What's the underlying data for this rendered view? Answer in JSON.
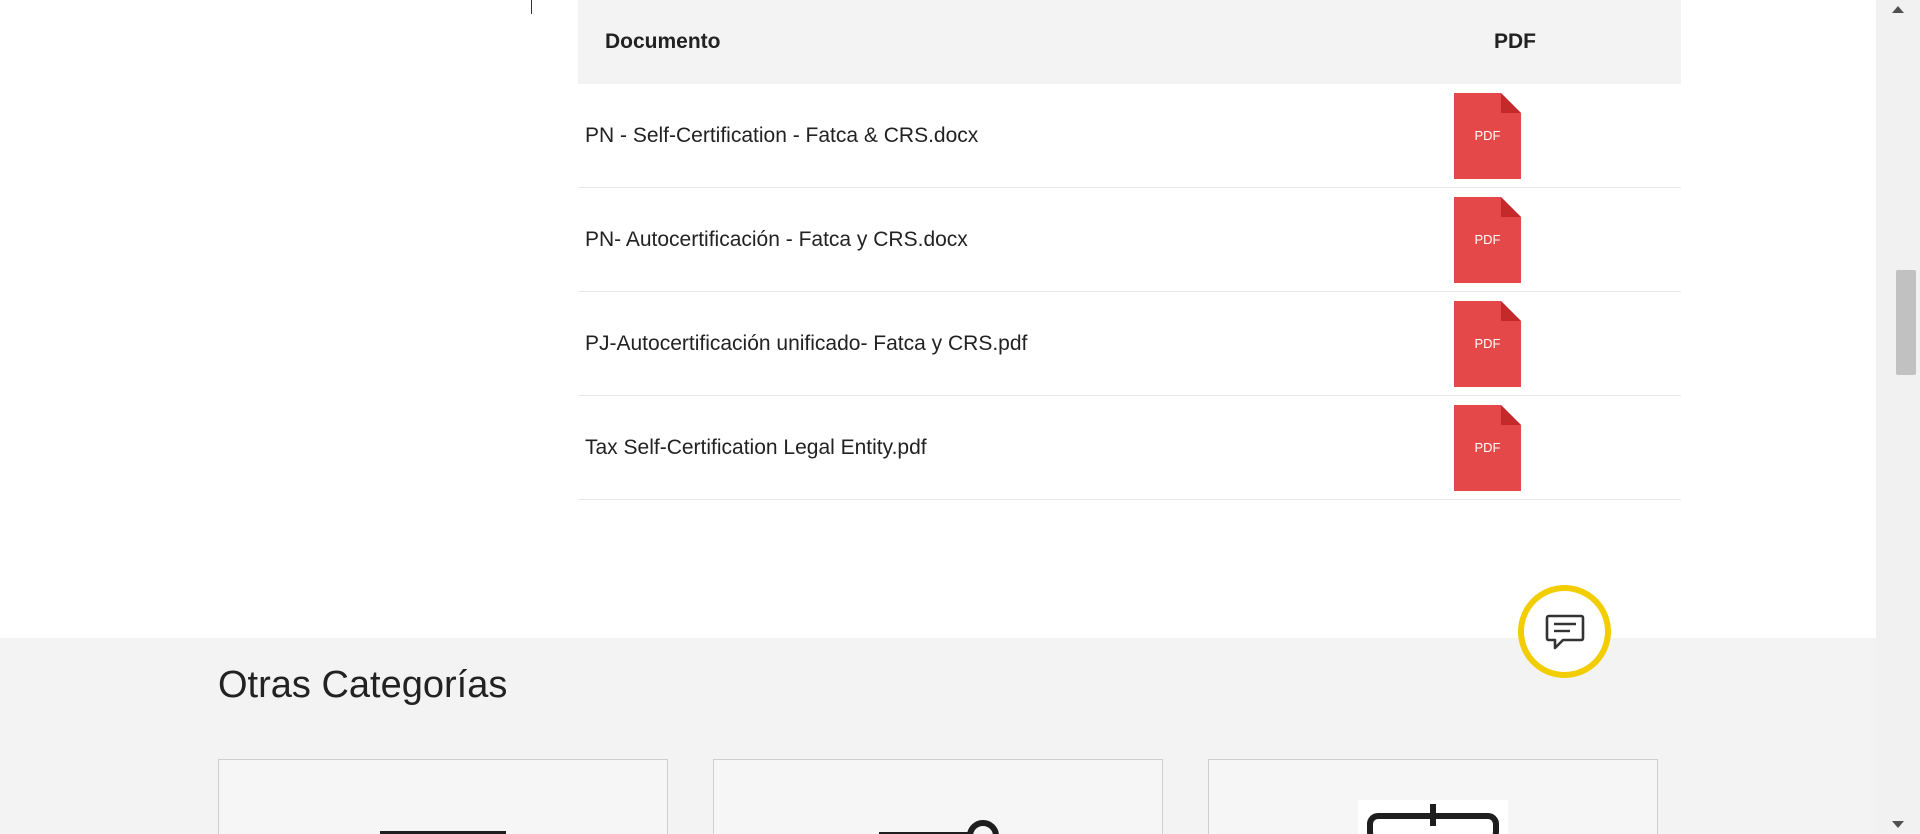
{
  "table": {
    "header": {
      "document": "Documento",
      "pdf": "PDF"
    },
    "rows": [
      {
        "name": "PN - Self-Certification - Fatca & CRS.docx",
        "icon": "pdf-file-icon",
        "icon_label": "PDF"
      },
      {
        "name": "PN- Autocertificación - Fatca y CRS.docx",
        "icon": "pdf-file-icon",
        "icon_label": "PDF"
      },
      {
        "name": "PJ-Autocertificación unificado- Fatca y CRS.pdf",
        "icon": "pdf-file-icon",
        "icon_label": "PDF"
      },
      {
        "name": "Tax Self-Certification Legal Entity.pdf",
        "icon": "pdf-file-icon",
        "icon_label": "PDF"
      }
    ]
  },
  "other_categories": {
    "title": "Otras Categorías",
    "cards": [
      {
        "icon": "document-icon"
      },
      {
        "icon": "key-icon"
      },
      {
        "icon": "form-icon"
      }
    ]
  },
  "chat": {
    "icon": "chat-icon"
  },
  "colors": {
    "pdf_red": "#e44848",
    "pdf_fold": "#c42a2a",
    "chat_ring": "#f2cd00",
    "section_bg": "#f3f3f3"
  }
}
